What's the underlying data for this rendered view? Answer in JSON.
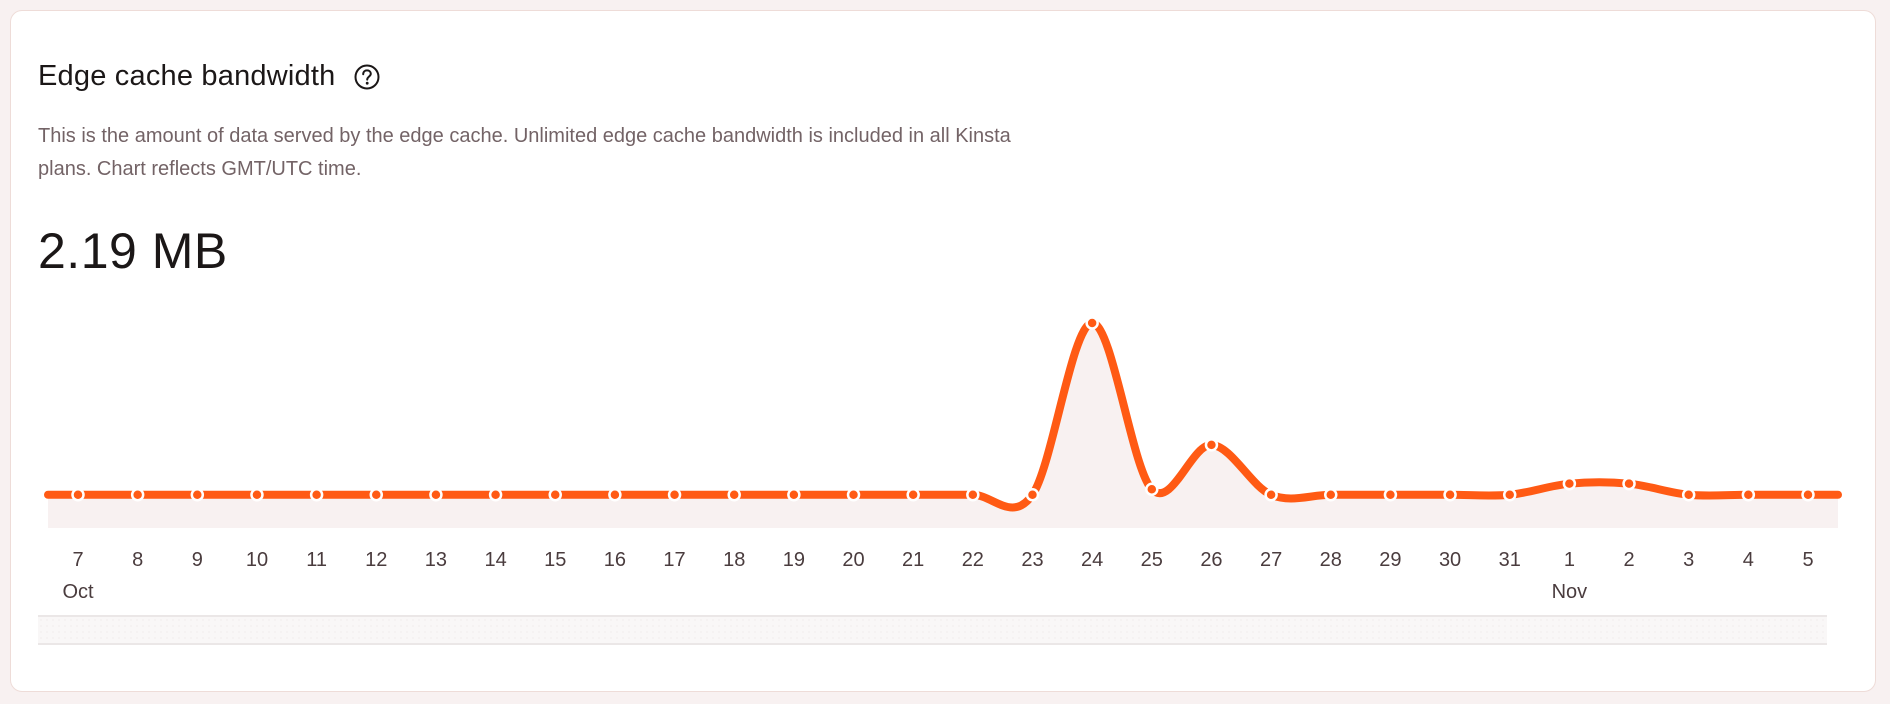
{
  "card": {
    "title": "Edge cache bandwidth",
    "help_icon": "question-circle-icon",
    "description": "This is the amount of data served by the edge cache. Unlimited edge cache bandwidth is included in all Kinsta plans. Chart reflects GMT/UTC time.",
    "total": "2.19 MB"
  },
  "colors": {
    "line": "#ff5a14",
    "area": "#f8f1f1",
    "text": "#1b1717",
    "muted": "#736366"
  },
  "chart_data": {
    "type": "area",
    "title": "Edge cache bandwidth",
    "xlabel": "",
    "ylabel": "",
    "unit": "MB",
    "grid": false,
    "legend": "none",
    "ylim": [
      0,
      0.37
    ],
    "categories": [
      "7",
      "8",
      "9",
      "10",
      "11",
      "12",
      "13",
      "14",
      "15",
      "16",
      "17",
      "18",
      "19",
      "20",
      "21",
      "22",
      "23",
      "24",
      "25",
      "26",
      "27",
      "28",
      "29",
      "30",
      "31",
      "1",
      "2",
      "3",
      "4",
      "5"
    ],
    "month_labels": [
      {
        "index": 0,
        "label": "Oct"
      },
      {
        "index": 25,
        "label": "Nov"
      }
    ],
    "series": [
      {
        "name": "Edge cache bandwidth",
        "values": [
          0.06,
          0.06,
          0.06,
          0.06,
          0.06,
          0.06,
          0.06,
          0.06,
          0.06,
          0.06,
          0.06,
          0.06,
          0.06,
          0.06,
          0.06,
          0.06,
          0.06,
          0.37,
          0.07,
          0.15,
          0.06,
          0.06,
          0.06,
          0.06,
          0.06,
          0.08,
          0.08,
          0.06,
          0.06,
          0.06
        ]
      }
    ]
  }
}
